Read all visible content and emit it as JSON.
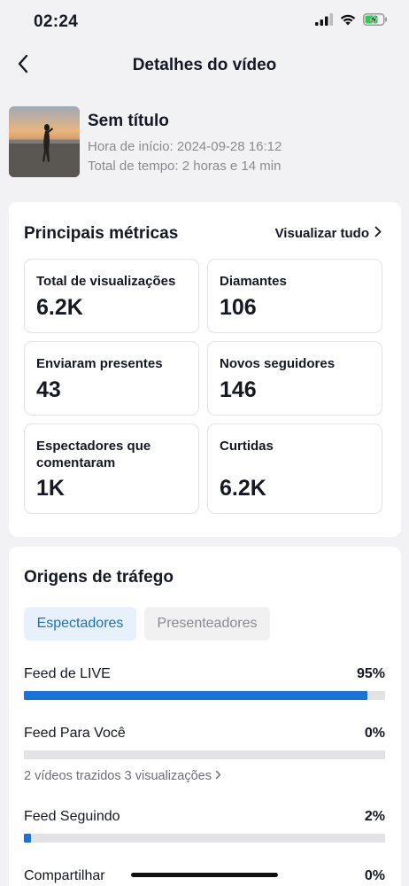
{
  "status_bar": {
    "time": "02:24"
  },
  "nav": {
    "title": "Detalhes do vídeo",
    "back_icon": "chevron-left-icon"
  },
  "video": {
    "title": "Sem título",
    "start_time": "Hora de início: 2024-09-28 16:12",
    "total_time": "Total de tempo: 2 horas e 14 min"
  },
  "metrics": {
    "title": "Principais métricas",
    "view_all": "Visualizar tudo",
    "items": [
      {
        "label": "Total de visualizações",
        "value": "6.2K"
      },
      {
        "label": "Diamantes",
        "value": "106"
      },
      {
        "label": "Enviaram presentes",
        "value": "43"
      },
      {
        "label": "Novos seguidores",
        "value": "146"
      },
      {
        "label": "Espectadores que comentaram",
        "value": "1K"
      },
      {
        "label": "Curtidas",
        "value": "6.2K"
      }
    ]
  },
  "traffic": {
    "title": "Origens de tráfego",
    "tabs": [
      {
        "label": "Espectadores",
        "active": true
      },
      {
        "label": "Presenteadores",
        "active": false
      }
    ],
    "sources": [
      {
        "name": "Feed de LIVE",
        "percent_label": "95%",
        "fill": 0.95,
        "sub": ""
      },
      {
        "name": "Feed Para Você",
        "percent_label": "0%",
        "fill": 0.0,
        "sub": "2 vídeos trazidos 3 visualizações"
      },
      {
        "name": "Feed Seguindo",
        "percent_label": "2%",
        "fill": 0.02,
        "sub": ""
      },
      {
        "name": "Compartilhar",
        "percent_label": "0%",
        "fill": 0.0,
        "sub": ""
      }
    ],
    "accent_color": "#1a73d9"
  }
}
